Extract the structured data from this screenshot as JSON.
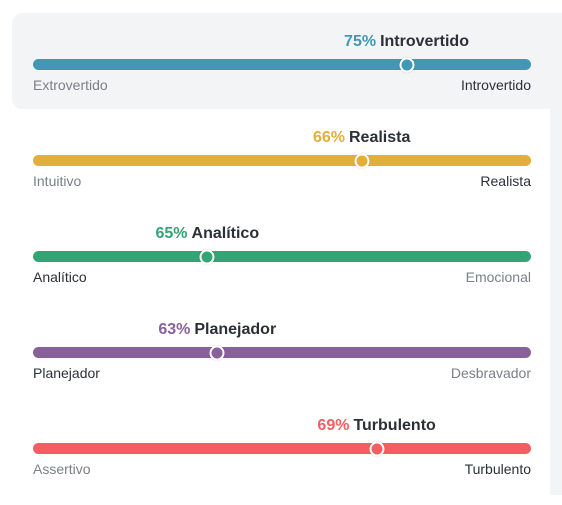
{
  "traits": [
    {
      "percent_label": "75%",
      "name": "Introvertido",
      "value": 0.75,
      "color": "#4298b4",
      "left_label": "Extrovertido",
      "right_label": "Introvertido",
      "selected_side": "right",
      "active": true
    },
    {
      "percent_label": "66%",
      "name": "Realista",
      "value": 0.66,
      "color": "#e4ae3a",
      "left_label": "Intuitivo",
      "right_label": "Realista",
      "selected_side": "right",
      "active": false
    },
    {
      "percent_label": "65%",
      "name": "Analítico",
      "value": 0.65,
      "color": "#33a474",
      "left_label": "Analítico",
      "right_label": "Emocional",
      "selected_side": "left",
      "active": false
    },
    {
      "percent_label": "63%",
      "name": "Planejador",
      "value": 0.63,
      "color": "#88619a",
      "left_label": "Planejador",
      "right_label": "Desbravador",
      "selected_side": "left",
      "active": false
    },
    {
      "percent_label": "69%",
      "name": "Turbulento",
      "value": 0.69,
      "color": "#f25e62",
      "left_label": "Assertivo",
      "right_label": "Turbulento",
      "selected_side": "right",
      "active": false
    }
  ]
}
